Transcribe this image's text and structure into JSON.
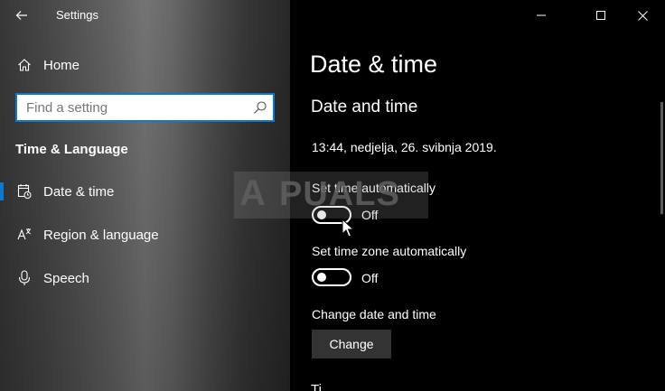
{
  "app": {
    "title": "Settings"
  },
  "sidebar": {
    "home_label": "Home",
    "search_placeholder": "Find a setting",
    "section_heading": "Time & Language",
    "items": [
      {
        "label": "Date & time",
        "icon": "calendar-clock-icon",
        "active": true
      },
      {
        "label": "Region & language",
        "icon": "region-language-icon",
        "active": false
      },
      {
        "label": "Speech",
        "icon": "microphone-icon",
        "active": false
      }
    ]
  },
  "main": {
    "page_title": "Date & time",
    "sub_title": "Date and time",
    "current_datetime": "13:44, nedjelja, 26. svibnja 2019.",
    "settings": [
      {
        "label": "Set time automatically",
        "state": "Off",
        "on": false
      },
      {
        "label": "Set time zone automatically",
        "state": "Off",
        "on": false
      }
    ],
    "change_section_label": "Change date and time",
    "change_button": "Change",
    "next_heading_partial": "Ti"
  },
  "watermark": {
    "text": "PUALS",
    "lead_letter": "A"
  },
  "colors": {
    "accent": "#0a79d4",
    "main_bg": "#000000",
    "button_bg": "#333333"
  }
}
